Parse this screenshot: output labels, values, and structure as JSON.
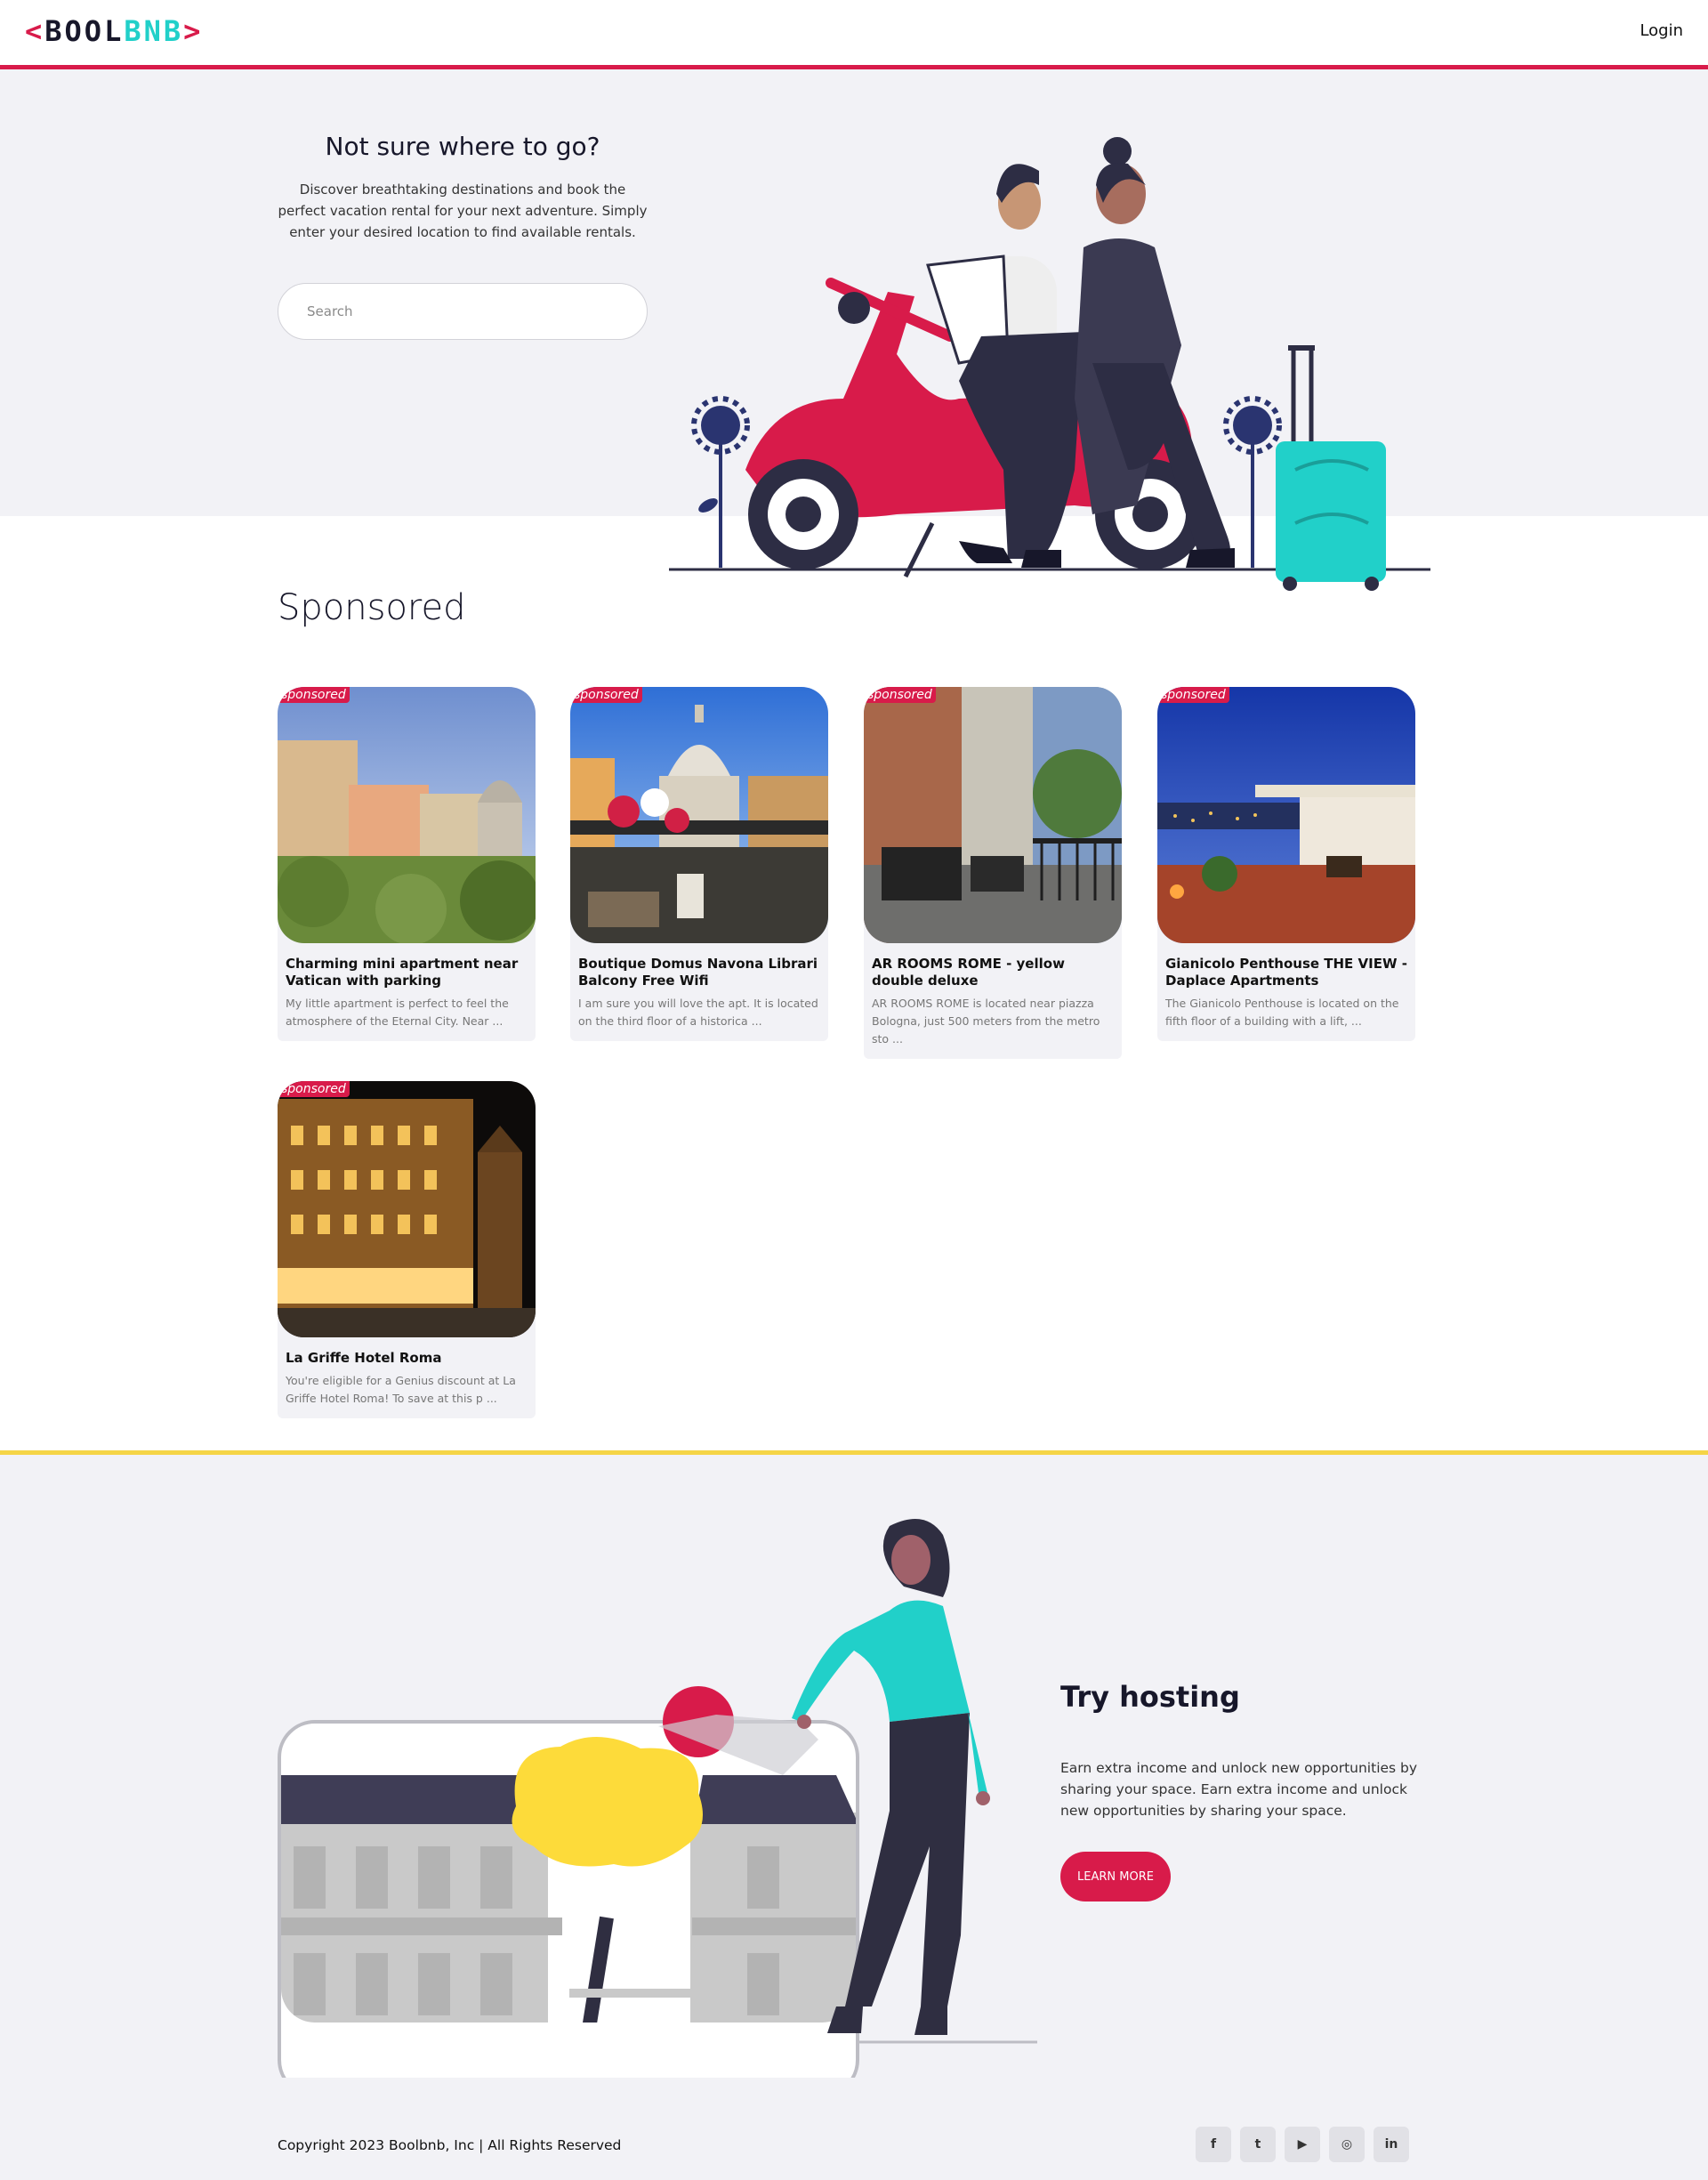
{
  "nav": {
    "logo_open": "<",
    "logo_part1": "BOOL",
    "logo_part2": "BNB",
    "logo_close": ">",
    "login_label": "Login"
  },
  "hero": {
    "title": "Not sure where to go?",
    "description": "Discover breathtaking destinations and book the perfect vacation rental for your next adventure. Simply enter your desired location to find available rentals.",
    "search_placeholder": "Search"
  },
  "sponsored": {
    "title": "Sponsored",
    "badge_label": "sponsored",
    "cards": [
      {
        "title": "Charming mini apartment near Vatican with parking",
        "description": "My little apartment is perfect to feel the atmosphere of the Eternal City. Near ..."
      },
      {
        "title": "Boutique Domus Navona Librari Balcony Free Wifi",
        "description": "I am sure you will love the apt. It is located on the third floor of a historica ..."
      },
      {
        "title": "AR ROOMS ROME - yellow double deluxe",
        "description": "AR ROOMS ROME is located near piazza Bologna, just 500 meters from the metro sto ..."
      },
      {
        "title": "Gianicolo Penthouse THE VIEW - Daplace Apartments",
        "description": "The Gianicolo Penthouse is located on the fifth floor of a building with a lift, ..."
      },
      {
        "title": "La Griffe Hotel Roma",
        "description": "You're eligible for a Genius discount at La Griffe Hotel Roma! To save at this p ..."
      }
    ]
  },
  "hosting": {
    "title": "Try hosting",
    "description": "Earn extra income and unlock new opportunities by sharing your space. Earn extra income and unlock new opportunities by sharing your space.",
    "button_label": "LEARN MORE"
  },
  "footer": {
    "copyright": "Copyright 2023 Boolbnb, Inc | All Rights Reserved",
    "socials": [
      {
        "icon": "facebook-icon",
        "glyph": "f"
      },
      {
        "icon": "twitter-icon",
        "glyph": "t"
      },
      {
        "icon": "youtube-icon",
        "glyph": "▶"
      },
      {
        "icon": "instagram-icon",
        "glyph": "◎"
      },
      {
        "icon": "linkedin-icon",
        "glyph": "in"
      }
    ]
  },
  "colors": {
    "brand": "#d81b4a",
    "teal": "#21d0c9",
    "navy": "#17172a",
    "accent_yellow": "#f5d547",
    "background_light": "#f2f2f6"
  }
}
